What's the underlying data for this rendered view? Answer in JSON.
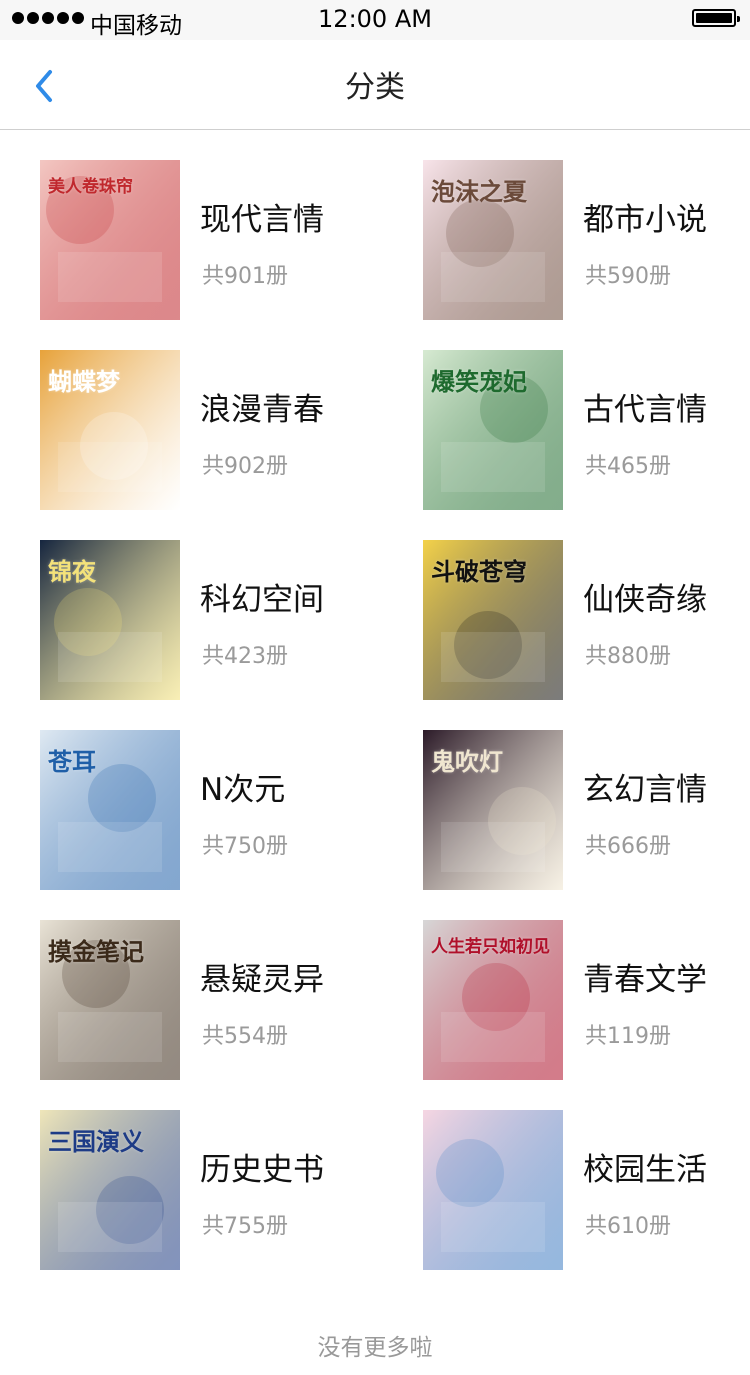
{
  "status_bar": {
    "carrier": "中国移动",
    "time": "12:00 AM"
  },
  "nav": {
    "title": "分类",
    "back_icon": "chevron-left-icon"
  },
  "categories": [
    {
      "name": "现代言情",
      "count": "共901册"
    },
    {
      "name": "都市小说",
      "count": "共590册"
    },
    {
      "name": "浪漫青春",
      "count": "共902册"
    },
    {
      "name": "古代言情",
      "count": "共465册"
    },
    {
      "name": "科幻空间",
      "count": "共423册"
    },
    {
      "name": "仙侠奇缘",
      "count": "共880册"
    },
    {
      "name": "N次元",
      "count": "共750册"
    },
    {
      "name": "玄幻言情",
      "count": "共666册"
    },
    {
      "name": "悬疑灵异",
      "count": "共554册"
    },
    {
      "name": "青春文学",
      "count": "共119册"
    },
    {
      "name": "历史史书",
      "count": "共755册"
    },
    {
      "name": "校园生活",
      "count": "共610册"
    }
  ],
  "covers": [
    {
      "text": "美人卷珠帘",
      "bg": "#f3c7c2",
      "accent": "#c0282d"
    },
    {
      "text": "泡沫之夏",
      "bg": "#f8e4ea",
      "accent": "#6b4a3a"
    },
    {
      "text": "蝴蝶梦",
      "bg": "#e7a23a",
      "accent": "#ffffff"
    },
    {
      "text": "爆笑宠妃",
      "bg": "#d7ead2",
      "accent": "#1e6a2e"
    },
    {
      "text": "锦夜",
      "bg": "#15253f",
      "accent": "#f4e27a"
    },
    {
      "text": "斗破苍穹",
      "bg": "#f4d24a",
      "accent": "#111111"
    },
    {
      "text": "苍耳",
      "bg": "#dfe9f2",
      "accent": "#1f5fa8"
    },
    {
      "text": "鬼吹灯",
      "bg": "#2b1a28",
      "accent": "#f0e6d0"
    },
    {
      "text": "摸金笔记",
      "bg": "#e9e3d6",
      "accent": "#3b2a1a"
    },
    {
      "text": "人生若只如初见",
      "bg": "#d7d7d7",
      "accent": "#b0102a"
    },
    {
      "text": "三国演义",
      "bg": "#efe6b9",
      "accent": "#1d3b86"
    },
    {
      "text": "",
      "bg": "#f6d6e2",
      "accent": "#3f7fc4"
    }
  ],
  "footer": {
    "note": "没有更多啦"
  }
}
